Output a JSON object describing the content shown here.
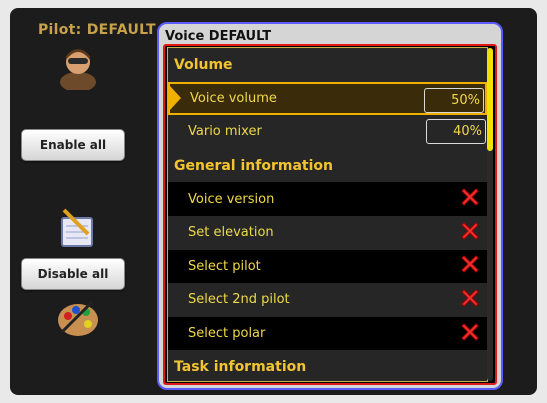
{
  "pilot_title": "Pilot: DEFAULT",
  "side_buttons": {
    "enable_all": "Enable all",
    "disable_all": "Disable all"
  },
  "dialog": {
    "title": "Voice DEFAULT",
    "sections": [
      {
        "header": "Volume",
        "items": [
          {
            "label": "Voice volume",
            "value": "50%",
            "selected": true
          },
          {
            "label": "Vario mixer",
            "value": "40%"
          }
        ]
      },
      {
        "header": "General information",
        "items": [
          {
            "label": "Voice version",
            "icon": "disabled-x-icon"
          },
          {
            "label": "Set elevation",
            "icon": "disabled-x-icon"
          },
          {
            "label": "Select pilot",
            "icon": "disabled-x-icon"
          },
          {
            "label": "Select 2nd pilot",
            "icon": "disabled-x-icon"
          },
          {
            "label": "Select polar",
            "icon": "disabled-x-icon"
          }
        ]
      },
      {
        "header": "Task information",
        "items": []
      }
    ]
  },
  "colors": {
    "accent_yellow": "#f3c431",
    "dialog_border": "#5b5bff",
    "inner_border": "#e01818",
    "disabled_x": "#e33"
  }
}
